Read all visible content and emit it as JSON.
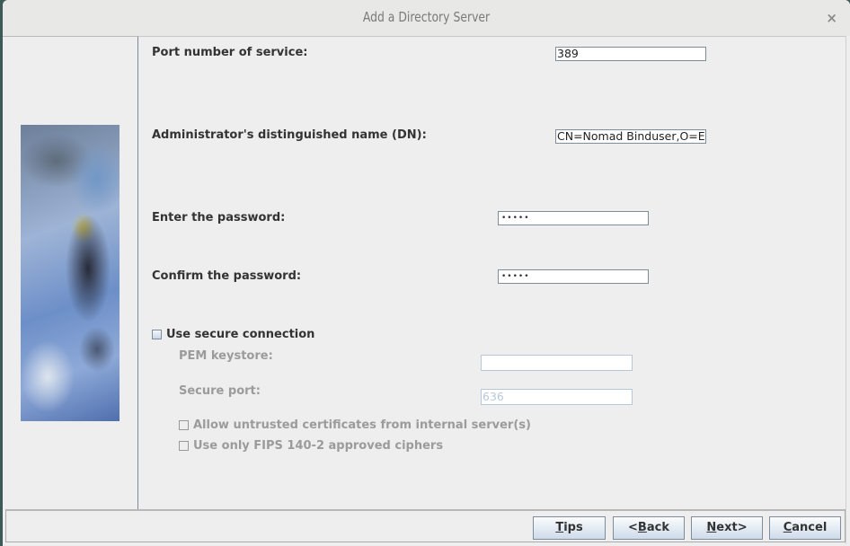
{
  "window": {
    "title": "Add a Directory Server",
    "close_icon": "×"
  },
  "form": {
    "port_label": "Port number of service:",
    "port_value": "389",
    "dn_label": "Administrator's distinguished name (DN):",
    "dn_value": "CN=Nomad Binduser,O=EX",
    "password_label": "Enter the password:",
    "password_value": "•••••",
    "confirm_label": "Confirm the password:",
    "confirm_value": "•••••",
    "secure_label": "Use secure connection",
    "secure_checked": false,
    "pem_label": "PEM keystore:",
    "pem_value": "",
    "secure_port_label": "Secure port:",
    "secure_port_value": "636",
    "untrusted_label": "Allow untrusted certificates from internal server(s)",
    "untrusted_checked": false,
    "fips_label": "Use only FIPS 140-2 approved ciphers",
    "fips_checked": false
  },
  "buttons": {
    "tips": {
      "mnemonic": "T",
      "rest": "ips"
    },
    "back": {
      "pre": "<",
      "mnemonic": "B",
      "rest": "ack"
    },
    "next": {
      "mnemonic": "N",
      "rest": "ext>"
    },
    "cancel": {
      "mnemonic": "C",
      "rest": "ancel"
    }
  }
}
